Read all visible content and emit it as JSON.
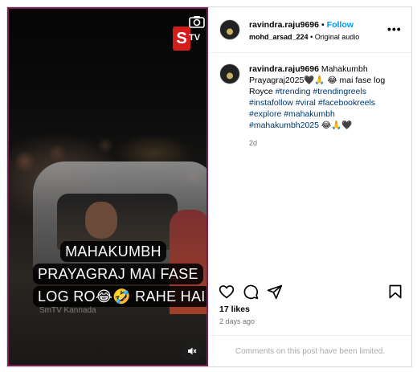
{
  "media": {
    "logo_letter": "S",
    "logo_suffix": "TV",
    "overlay_lines": [
      "MAHAKUMBH",
      "PRAYAGRAJ MAI FASE",
      "LOG RO😂🤣 RAHE HAI"
    ],
    "watermark": "SmTV Kannada",
    "icons": {
      "camera": "camera-icon",
      "mute": "speaker-muted-icon"
    },
    "border_color": "#7a1f55"
  },
  "header": {
    "username": "ravindra.raju9696",
    "separator": "•",
    "follow_label": "Follow",
    "collaborator": "mohd_arsad_224",
    "audio_separator": "•",
    "audio_label": "Original audio",
    "more_label": "•••"
  },
  "caption": {
    "username": "ravindra.raju9696",
    "text_before_tags": " Mahakumbh Prayagraj2025🖤🙏 😂 mai fase log Royce ",
    "tags": [
      "#trending",
      "#trendingreels",
      "#instafollow",
      "#viral",
      "#facebookreels",
      "#explore",
      "#mahakumbh",
      "#mahakumbh2025"
    ],
    "trailing_emoji": " 😂🙏🖤",
    "age": "2d"
  },
  "actions": {
    "icons": [
      "heart-icon",
      "comment-icon",
      "share-icon",
      "bookmark-icon"
    ]
  },
  "stats": {
    "likes": "17 likes",
    "posted": "2 days ago"
  },
  "footer": {
    "message": "Comments on this post have been limited."
  },
  "colors": {
    "link": "#0095f6",
    "hashtag": "#00376b",
    "muted": "#737373"
  }
}
